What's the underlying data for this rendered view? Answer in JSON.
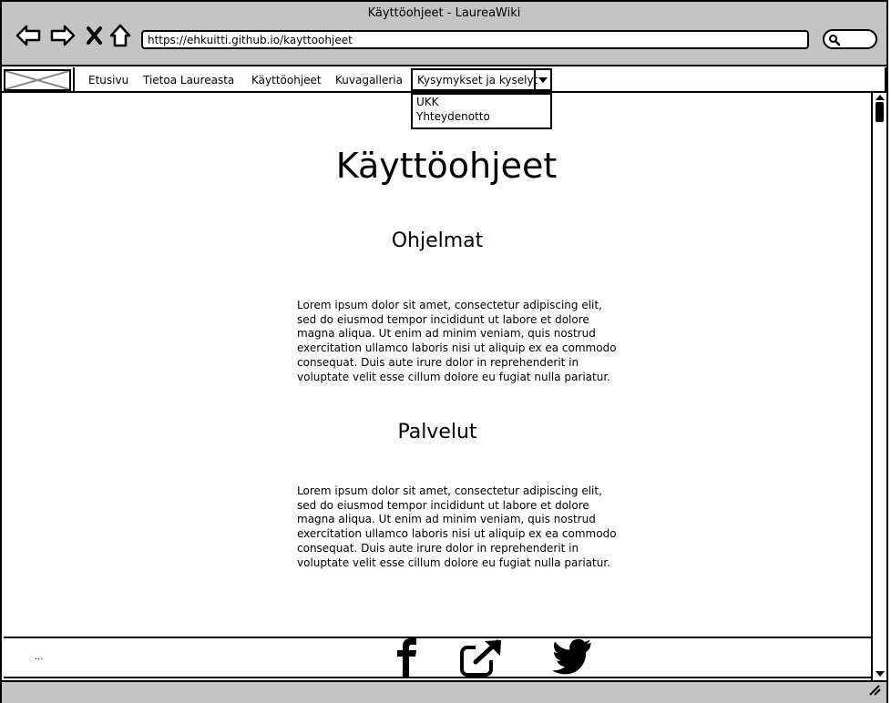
{
  "window": {
    "title": "Käyttöohjeet - LaureaWiki"
  },
  "browser": {
    "url": "https://ehkuitti.github.io/kayttoohjeet",
    "icons": [
      "back-icon",
      "forward-icon",
      "close-icon",
      "home-icon",
      "search-icon"
    ]
  },
  "menu": {
    "items": [
      "Etusivu",
      "Tietoa Laureasta",
      "Käyttöohjeet",
      "Kuvagalleria"
    ],
    "dropdown": {
      "label": "Kysymykset ja kyselyt",
      "options": [
        "UKK",
        "Yhteydenotto"
      ]
    }
  },
  "page": {
    "title": "Käyttöohjeet",
    "sections": [
      {
        "heading": "Ohjelmat",
        "text": "Lorem ipsum dolor sit amet, consectetur adipiscing elit, sed do eiusmod tempor incididunt ut labore et dolore magna aliqua. Ut enim ad minim veniam, quis nostrud exercitation ullamco laboris nisi ut aliquip ex ea commodo consequat. Duis aute irure dolor in reprehenderit in voluptate velit esse cillum dolore eu fugiat nulla pariatur."
      },
      {
        "heading": "Palvelut",
        "text": "Lorem ipsum dolor sit amet, consectetur adipiscing elit, sed do eiusmod tempor incididunt ut labore et dolore magna aliqua. Ut enim ad minim veniam, quis nostrud exercitation ullamco laboris nisi ut aliquip ex ea commodo consequat. Duis aute irure dolor in reprehenderit in voluptate velit esse cillum dolore eu fugiat nulla pariatur."
      }
    ]
  },
  "footer": {
    "text": "...",
    "icons": [
      "facebook-icon",
      "external-link-icon",
      "twitter-icon"
    ]
  }
}
